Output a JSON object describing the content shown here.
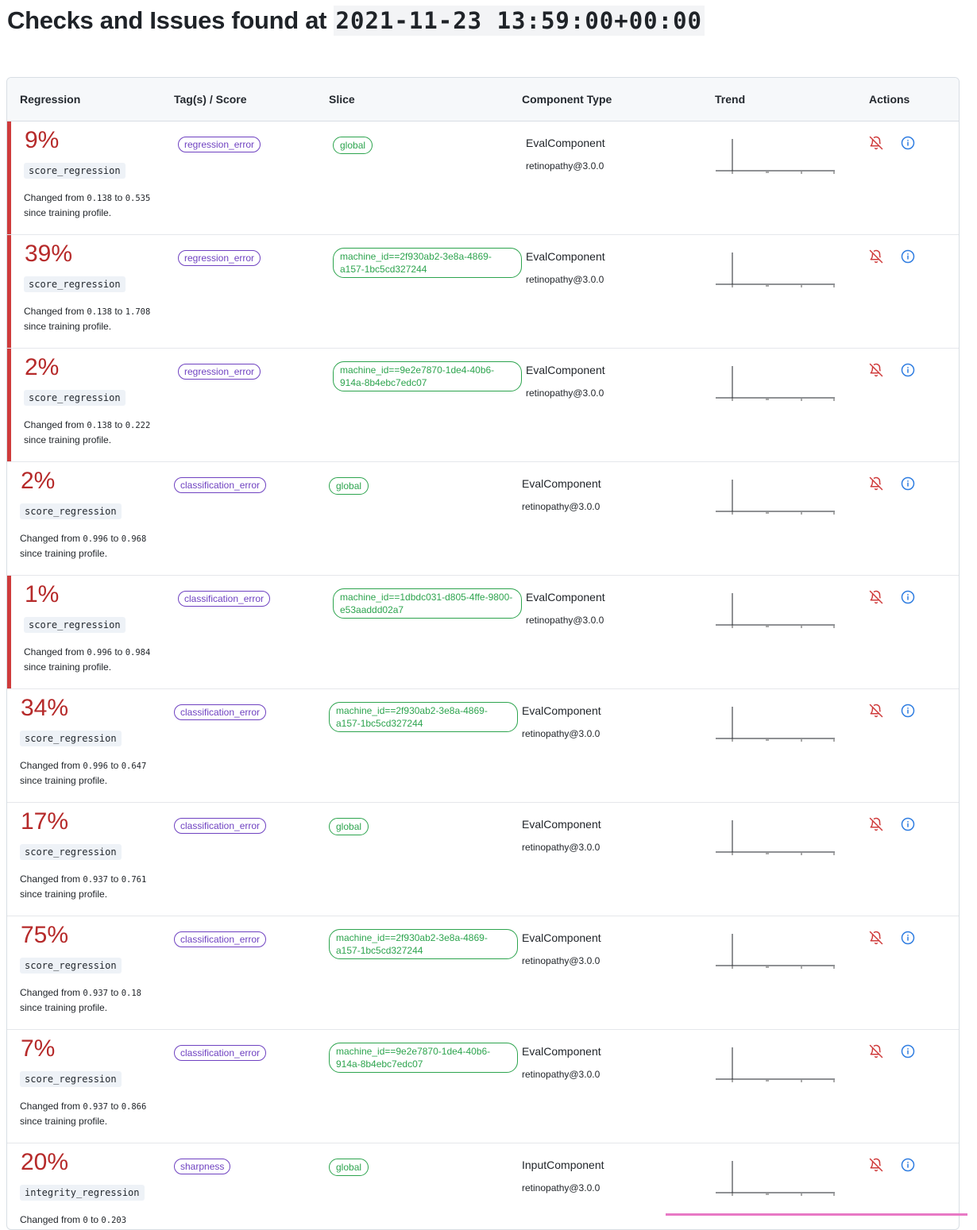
{
  "header": {
    "title_prefix": "Checks and Issues found at",
    "timestamp": "2021-11-23 13:59:00+00:00"
  },
  "columns": [
    "Regression",
    "Tag(s) / Score",
    "Slice",
    "Component Type",
    "Trend",
    "Actions"
  ],
  "changed_prefix": "Changed from",
  "changed_to": "to",
  "changed_suffix": "since training profile.",
  "icons": {
    "mute": "bell-off-icon",
    "info": "info-icon"
  },
  "colors": {
    "regression": "#b62a2a",
    "tag": "#6f42c1",
    "slice": "#2da44e",
    "flag": "#cf3b3b"
  },
  "rows": [
    {
      "flag": true,
      "pct": "9%",
      "metric": "score_regression",
      "from": "0.138",
      "to": "0.535",
      "tag": "classification_error_tag",
      "tag_text": "regression_error",
      "slice": "global",
      "component": "EvalComponent",
      "version": "retinopathy@3.0.0"
    },
    {
      "flag": true,
      "pct": "39%",
      "metric": "score_regression",
      "from": "0.138",
      "to": "1.708",
      "tag_text": "regression_error",
      "slice": "machine_id==2f930ab2-3e8a-4869-a157-1bc5cd327244",
      "component": "EvalComponent",
      "version": "retinopathy@3.0.0"
    },
    {
      "flag": true,
      "pct": "2%",
      "metric": "score_regression",
      "from": "0.138",
      "to": "0.222",
      "tag_text": "regression_error",
      "slice": "machine_id==9e2e7870-1de4-40b6-914a-8b4ebc7edc07",
      "component": "EvalComponent",
      "version": "retinopathy@3.0.0"
    },
    {
      "flag": false,
      "pct": "2%",
      "metric": "score_regression",
      "from": "0.996",
      "to": "0.968",
      "tag_text": "classification_error",
      "slice": "global",
      "component": "EvalComponent",
      "version": "retinopathy@3.0.0"
    },
    {
      "flag": true,
      "pct": "1%",
      "metric": "score_regression",
      "from": "0.996",
      "to": "0.984",
      "tag_text": "classification_error",
      "slice": "machine_id==1dbdc031-d805-4ffe-9800-e53aaddd02a7",
      "component": "EvalComponent",
      "version": "retinopathy@3.0.0"
    },
    {
      "flag": false,
      "pct": "34%",
      "metric": "score_regression",
      "from": "0.996",
      "to": "0.647",
      "tag_text": "classification_error",
      "slice": "machine_id==2f930ab2-3e8a-4869-a157-1bc5cd327244",
      "component": "EvalComponent",
      "version": "retinopathy@3.0.0"
    },
    {
      "flag": false,
      "pct": "17%",
      "metric": "score_regression",
      "from": "0.937",
      "to": "0.761",
      "tag_text": "classification_error",
      "slice": "global",
      "component": "EvalComponent",
      "version": "retinopathy@3.0.0"
    },
    {
      "flag": false,
      "pct": "75%",
      "metric": "score_regression",
      "from": "0.937",
      "to": "0.18",
      "tag_text": "classification_error",
      "slice": "machine_id==2f930ab2-3e8a-4869-a157-1bc5cd327244",
      "component": "EvalComponent",
      "version": "retinopathy@3.0.0"
    },
    {
      "flag": false,
      "pct": "7%",
      "metric": "score_regression",
      "from": "0.937",
      "to": "0.866",
      "tag_text": "classification_error",
      "slice": "machine_id==9e2e7870-1de4-40b6-914a-8b4ebc7edc07",
      "component": "EvalComponent",
      "version": "retinopathy@3.0.0"
    },
    {
      "flag": false,
      "pct": "20%",
      "metric": "integrity_regression",
      "from": "0",
      "to": "0.203",
      "tag_text": "sharpness",
      "slice": "global",
      "component": "InputComponent",
      "version": "retinopathy@3.0.0"
    }
  ]
}
